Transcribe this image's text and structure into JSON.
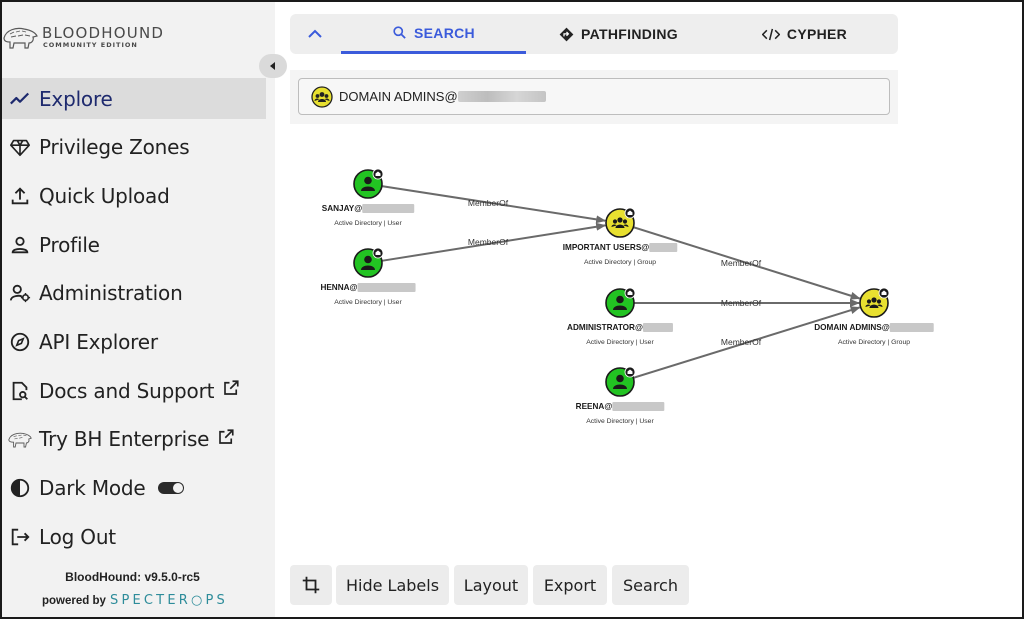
{
  "brand": {
    "name": "BLOODHOUND",
    "sub": "COMMUNITY EDITION"
  },
  "nav": {
    "items": [
      {
        "label": "Explore",
        "icon": "trend-line-icon",
        "active": true
      },
      {
        "label": "Privilege Zones",
        "icon": "gem-icon"
      },
      {
        "label": "Quick Upload",
        "icon": "upload-icon"
      },
      {
        "label": "Profile",
        "icon": "person-icon"
      },
      {
        "label": "Administration",
        "icon": "user-gear-icon"
      },
      {
        "label": "API Explorer",
        "icon": "compass-icon"
      },
      {
        "label": "Docs and Support",
        "icon": "document-search-icon",
        "external": true
      },
      {
        "label": "Try BH Enterprise",
        "icon": "hound-icon",
        "external": true
      },
      {
        "label": "Dark Mode",
        "icon": "contrast-icon",
        "toggle": true
      },
      {
        "label": "Log Out",
        "icon": "logout-icon"
      }
    ]
  },
  "footer": {
    "version": "BloodHound: v9.5.0-rc5",
    "powered": "powered by",
    "specter": "SPECTER○PS"
  },
  "tabs": {
    "search": "SEARCH",
    "pathfinding": "PATHFINDING",
    "cypher": "CYPHER",
    "active": "search"
  },
  "search": {
    "value": "DOMAIN ADMINS@"
  },
  "graph": {
    "nodes": [
      {
        "id": "sanjay",
        "label": "SANJAY@",
        "sub": "Active Directory | User",
        "kind": "user"
      },
      {
        "id": "henna",
        "label": "HENNA@",
        "sub": "Active Directory | User",
        "kind": "user"
      },
      {
        "id": "important",
        "label": "IMPORTANT USERS@",
        "sub": "Active Directory | Group",
        "kind": "group"
      },
      {
        "id": "administrator",
        "label": "ADMINISTRATOR@",
        "sub": "Active Directory | User",
        "kind": "user"
      },
      {
        "id": "reena",
        "label": "REENA@",
        "sub": "Active Directory | User",
        "kind": "user"
      },
      {
        "id": "domainadmins",
        "label": "DOMAIN ADMINS@",
        "sub": "Active Directory | Group",
        "kind": "group"
      }
    ],
    "edges": [
      {
        "from": "sanjay",
        "to": "important",
        "label": "MemberOf"
      },
      {
        "from": "henna",
        "to": "important",
        "label": "MemberOf"
      },
      {
        "from": "important",
        "to": "domainadmins",
        "label": "MemberOf"
      },
      {
        "from": "administrator",
        "to": "domainadmins",
        "label": "MemberOf"
      },
      {
        "from": "reena",
        "to": "domainadmins",
        "label": "MemberOf"
      }
    ],
    "colors": {
      "user": "#22c322",
      "group": "#e8e030",
      "edge": "#6a6a6a"
    }
  },
  "toolbar": {
    "hide_labels": "Hide Labels",
    "layout": "Layout",
    "export": "Export",
    "search": "Search"
  }
}
